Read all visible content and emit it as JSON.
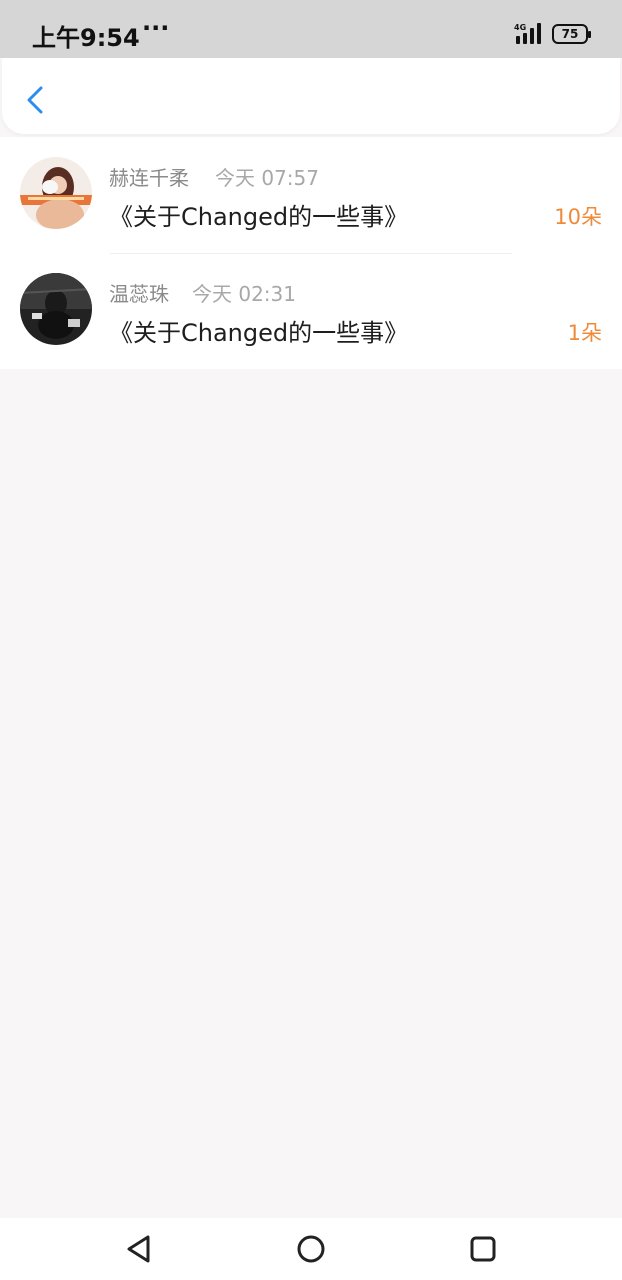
{
  "status_bar": {
    "time": "上午9:54",
    "more": "···",
    "network": "4G",
    "battery": "75"
  },
  "header": {
    "back_icon": "chevron-left-icon",
    "accent_color": "#2a8ef0"
  },
  "list": {
    "items": [
      {
        "name": "赫连千柔",
        "time": "今天 07:57",
        "title": "《关于Changed的一些事》",
        "count": "10朵"
      },
      {
        "name": "温蕊珠",
        "time": "今天 02:31",
        "title": "《关于Changed的一些事》",
        "count": "1朵"
      }
    ],
    "count_color": "#ee8b3a"
  },
  "nav_bar": {
    "back_icon": "triangle-back-icon",
    "home_icon": "circle-home-icon",
    "recents_icon": "square-recents-icon"
  }
}
